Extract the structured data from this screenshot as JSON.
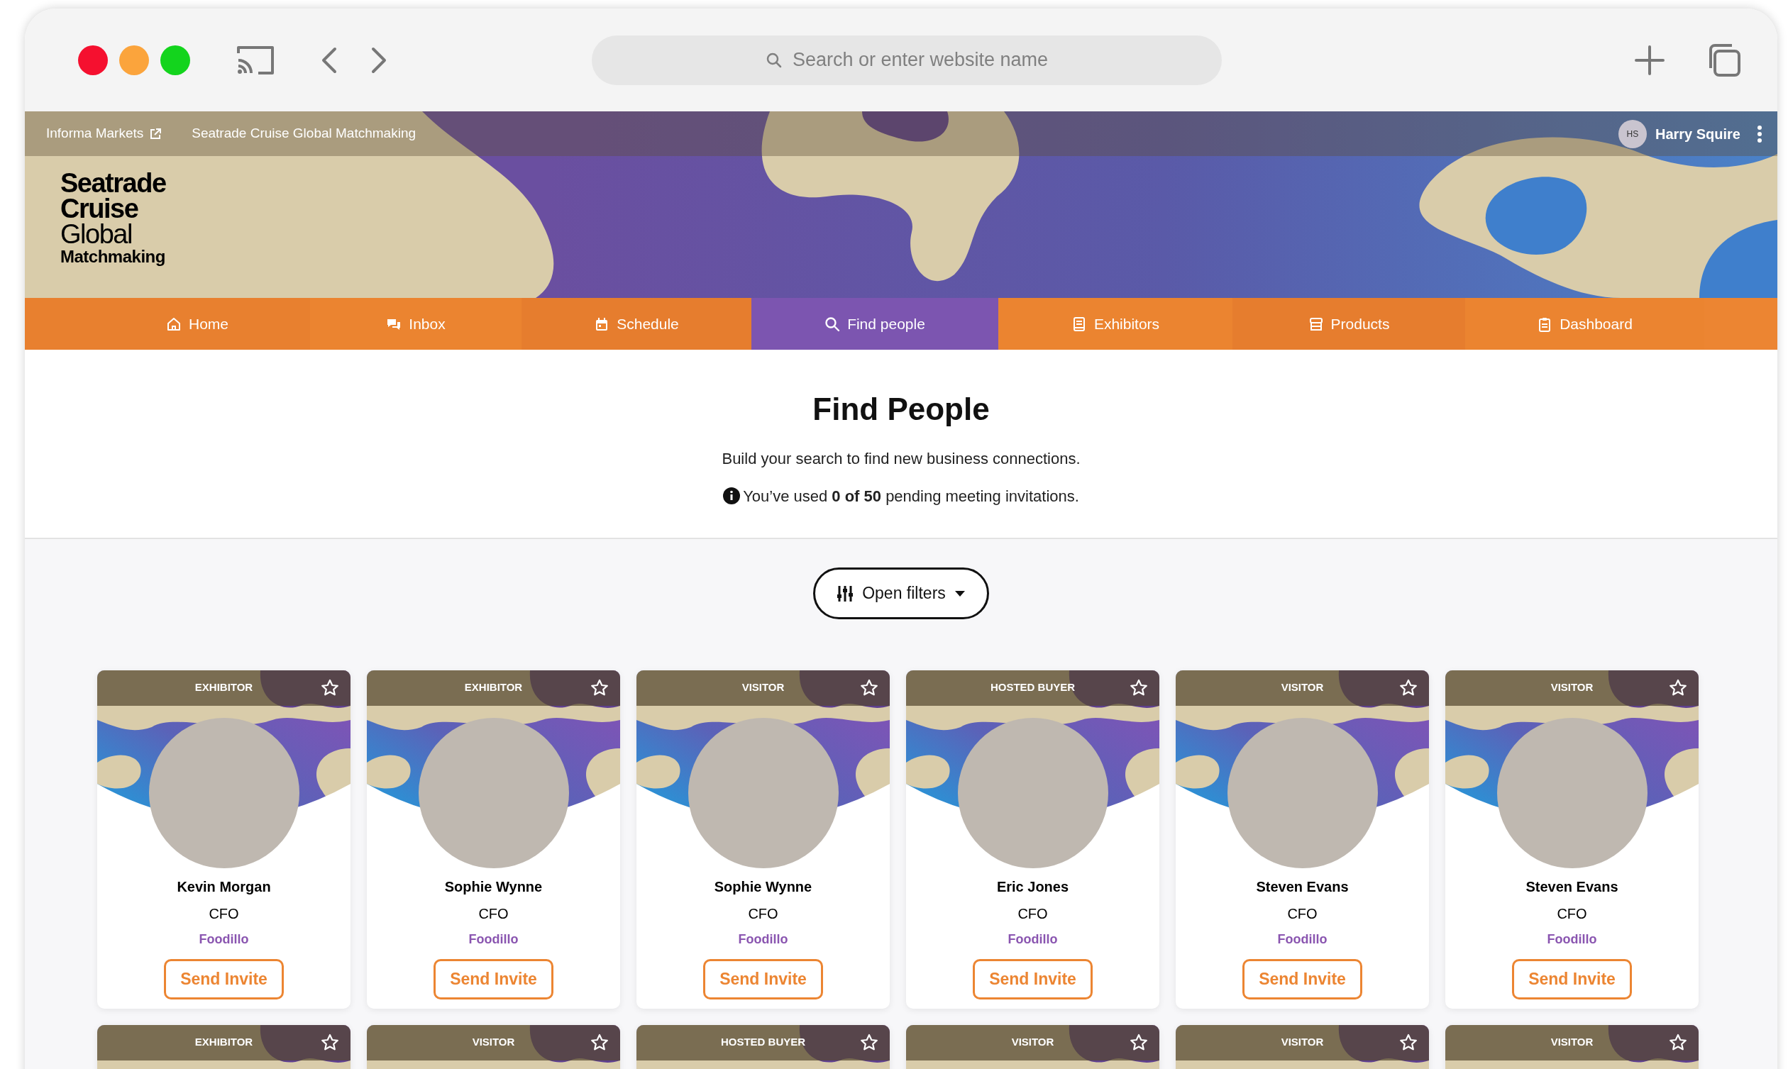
{
  "browser": {
    "search_placeholder": "Search or enter website name"
  },
  "top_bar": {
    "links": [
      {
        "label": "Informa Markets",
        "external": true
      },
      {
        "label": "Seatrade Cruise Global Matchmaking",
        "external": false
      }
    ],
    "user": {
      "initials": "HS",
      "name": "Harry Squire"
    }
  },
  "logo": [
    {
      "text": "Seatrade",
      "kind": "heavy"
    },
    {
      "text": "Cruise",
      "kind": "heavy"
    },
    {
      "text": "Global",
      "kind": "light"
    },
    {
      "text": "Matchmaking",
      "kind": "small"
    }
  ],
  "nav": [
    {
      "label": "Home",
      "selected": false
    },
    {
      "label": "Inbox",
      "selected": false
    },
    {
      "label": "Schedule",
      "selected": false
    },
    {
      "label": "Find people",
      "selected": true
    },
    {
      "label": "Exhibitors",
      "selected": false
    },
    {
      "label": "Products",
      "selected": false
    },
    {
      "label": "Dashboard",
      "selected": false
    }
  ],
  "page": {
    "title": "Find People",
    "subtitle": "Build your search to find new business connections.",
    "usage": "You’ve used **0 of 50** pending meeting invitations.",
    "filter_button": "Open filters"
  },
  "people": [
    {
      "role": "EXHIBITOR",
      "name": "Kevin Morgan",
      "title": "CFO",
      "company": "Foodillo",
      "action": "Send Invite"
    },
    {
      "role": "EXHIBITOR",
      "name": "Sophie Wynne",
      "title": "CFO",
      "company": "Foodillo",
      "action": "Send Invite"
    },
    {
      "role": "VISITOR",
      "name": "Sophie Wynne",
      "title": "CFO",
      "company": "Foodillo",
      "action": "Send Invite"
    },
    {
      "role": "HOSTED BUYER",
      "name": "Eric Jones",
      "title": "CFO",
      "company": "Foodillo",
      "action": "Send Invite"
    },
    {
      "role": "VISITOR",
      "name": "Steven Evans",
      "title": "CFO",
      "company": "Foodillo",
      "action": "Send Invite"
    },
    {
      "role": "VISITOR",
      "name": "Steven Evans",
      "title": "CFO",
      "company": "Foodillo",
      "action": "Send Invite"
    },
    {
      "role": "EXHIBITOR"
    },
    {
      "role": "VISITOR"
    },
    {
      "role": "HOSTED BUYER"
    },
    {
      "role": "VISITOR"
    },
    {
      "role": "VISITOR"
    },
    {
      "role": "VISITOR"
    }
  ]
}
